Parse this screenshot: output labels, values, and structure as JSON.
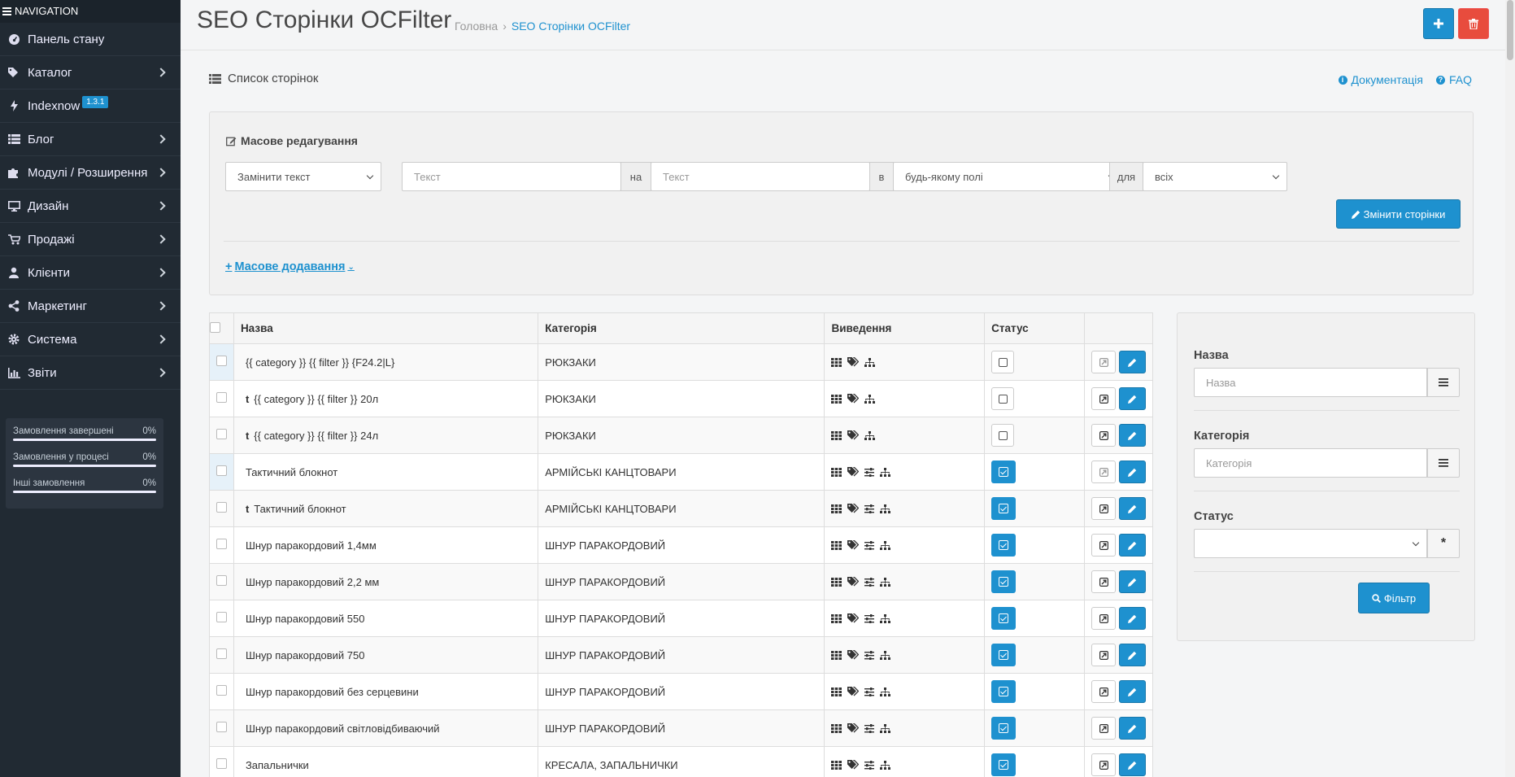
{
  "sidebar": {
    "header": "NAVIGATION",
    "items": [
      {
        "label": "Панель стану",
        "icon": "dashboard-icon",
        "chevron": false
      },
      {
        "label": "Каталог",
        "icon": "tags-icon",
        "chevron": true
      },
      {
        "label": "Indexnow",
        "icon": "bolt-icon",
        "chevron": false,
        "badge": "1.3.1"
      },
      {
        "label": "Блог",
        "icon": "list-icon",
        "chevron": true
      },
      {
        "label": "Модулі / Розширення",
        "icon": "puzzle-icon",
        "chevron": true
      },
      {
        "label": "Дизайн",
        "icon": "desktop-icon",
        "chevron": true
      },
      {
        "label": "Продажі",
        "icon": "cart-icon",
        "chevron": true
      },
      {
        "label": "Клієнти",
        "icon": "user-icon",
        "chevron": true
      },
      {
        "label": "Маркетинг",
        "icon": "share-icon",
        "chevron": true
      },
      {
        "label": "Система",
        "icon": "cog-icon",
        "chevron": true
      },
      {
        "label": "Звіти",
        "icon": "bar-chart-icon",
        "chevron": true
      }
    ],
    "stats": [
      {
        "label": "Замовлення завершені",
        "value": "0%"
      },
      {
        "label": "Замовлення у процесі",
        "value": "0%"
      },
      {
        "label": "Інші замовлення",
        "value": "0%"
      }
    ]
  },
  "header": {
    "title": "SEO Сторінки OCFilter",
    "breadcrumb": {
      "home": "Головна",
      "current": "SEO Сторінки OCFilter"
    }
  },
  "panel": {
    "title": "Список сторінок",
    "doc_link": "Документація",
    "faq_link": "FAQ"
  },
  "mass_edit": {
    "title": "Масове редагування",
    "action_select": "Замінити текст",
    "text_from_placeholder": "Текст",
    "on_label": "на",
    "text_to_placeholder": "Текст",
    "in_label": "в",
    "field_select": "будь-якому полі",
    "for_label": "для",
    "scope_select": "всіх",
    "change_button": "Змінити сторінки",
    "mass_add_link": "Масове додавання"
  },
  "table": {
    "columns": [
      "Назва",
      "Категорія",
      "Виведення",
      "Статус"
    ],
    "rows": [
      {
        "name": "{{ category }} {{ filter }} {F24.2|L}",
        "child": false,
        "category": "РЮКЗАКИ",
        "icons": 3,
        "status": false,
        "highlight": true
      },
      {
        "name": "{{ category }} {{ filter }} 20л",
        "child": true,
        "category": "РЮКЗАКИ",
        "icons": 3,
        "status": false,
        "highlight": false
      },
      {
        "name": "{{ category }} {{ filter }} 24л",
        "child": true,
        "category": "РЮКЗАКИ",
        "icons": 3,
        "status": false,
        "highlight": false
      },
      {
        "name": "Тактичний блокнот",
        "child": false,
        "category": "АРМІЙСЬКІ КАНЦТОВАРИ",
        "icons": 4,
        "status": true,
        "highlight": true
      },
      {
        "name": "Тактичний блокнот",
        "child": true,
        "category": "АРМІЙСЬКІ КАНЦТОВАРИ",
        "icons": 4,
        "status": true,
        "highlight": false
      },
      {
        "name": "Шнур паракордовий 1,4мм",
        "child": false,
        "category": "ШНУР ПАРАКОРДОВИЙ",
        "icons": 4,
        "status": true,
        "highlight": false
      },
      {
        "name": "Шнур паракордовий 2,2 мм",
        "child": false,
        "category": "ШНУР ПАРАКОРДОВИЙ",
        "icons": 4,
        "status": true,
        "highlight": false
      },
      {
        "name": "Шнур паракордовий 550",
        "child": false,
        "category": "ШНУР ПАРАКОРДОВИЙ",
        "icons": 4,
        "status": true,
        "highlight": false
      },
      {
        "name": "Шнур паракордовий 750",
        "child": false,
        "category": "ШНУР ПАРАКОРДОВИЙ",
        "icons": 4,
        "status": true,
        "highlight": false
      },
      {
        "name": "Шнур паракордовий без серцевини",
        "child": false,
        "category": "ШНУР ПАРАКОРДОВИЙ",
        "icons": 4,
        "status": true,
        "highlight": false
      },
      {
        "name": "Шнур паракордовий світловідбиваючий",
        "child": false,
        "category": "ШНУР ПАРАКОРДОВИЙ",
        "icons": 4,
        "status": true,
        "highlight": false
      },
      {
        "name": "Запальнички",
        "child": false,
        "category": "КРЕСАЛА, ЗАПАЛЬНИЧКИ",
        "icons": 4,
        "status": true,
        "highlight": false
      }
    ]
  },
  "filter": {
    "name_label": "Назва",
    "name_placeholder": "Назва",
    "category_label": "Категорія",
    "category_placeholder": "Категорія",
    "status_label": "Статус",
    "status_value": "",
    "filter_button": "Фільтр"
  },
  "colors": {
    "primary": "#1e91cf",
    "danger": "#e84c3d",
    "sidebar": "#212a33"
  }
}
